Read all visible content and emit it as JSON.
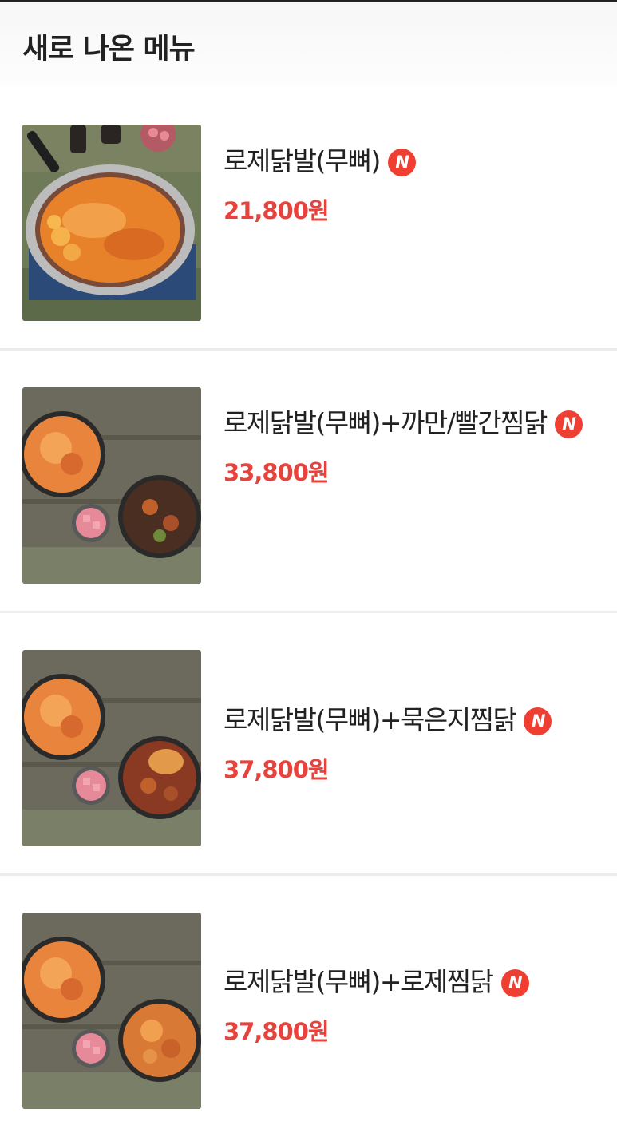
{
  "header": {
    "title": "새로 나온 메뉴"
  },
  "badge_label": "N",
  "menu_items": [
    {
      "name": "로제닭발(무뼈)",
      "price": "21,800원",
      "image": "rose-chicken-feet-pan-photo"
    },
    {
      "name": "로제닭발(무뼈)+까만/빨간찜닭",
      "price": "33,800원",
      "image": "rose-chicken-feet-and-braised-chicken-photo"
    },
    {
      "name": "로제닭발(무뼈)+묵은지찜닭",
      "price": "37,800원",
      "image": "rose-chicken-feet-and-kimchi-braised-chicken-photo"
    },
    {
      "name": "로제닭발(무뼈)+로제찜닭",
      "price": "37,800원",
      "image": "rose-chicken-feet-and-rose-braised-chicken-photo"
    }
  ],
  "colors": {
    "price": "#e9423c",
    "badge": "#ef3f32",
    "text": "#222222"
  }
}
